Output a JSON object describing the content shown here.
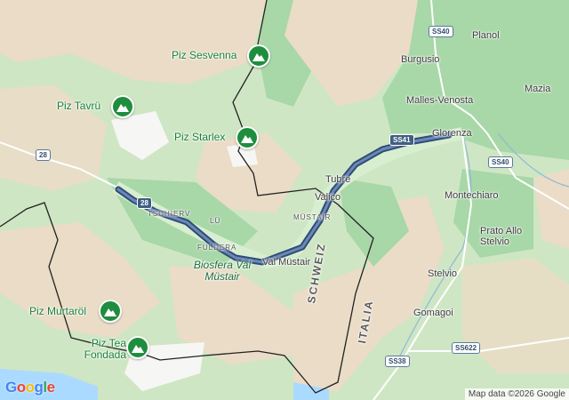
{
  "map": {
    "attribution": "Map data ©2026 Google",
    "logo": {
      "letters": [
        "G",
        "o",
        "o",
        "g",
        "l",
        "e"
      ],
      "colors": [
        "#4285F4",
        "#EA4335",
        "#FBBC05",
        "#4285F4",
        "#34A853",
        "#EA4335"
      ]
    },
    "colors": {
      "route": "#3a5a8a",
      "terrain_green": "#cfe6c4",
      "mountain_tan": "#eadcc6",
      "peak_marker": "#1e8e3e",
      "border": "#222222"
    },
    "places": {
      "planol": "Planol",
      "burgusio": "Burgusio",
      "mazia": "Mazia",
      "malles_venosta": "Malles-Venosta",
      "glorenza": "Glorenza",
      "tubre": "Tubre",
      "valico": "Valico",
      "montechiaro": "Montechiaro",
      "prato_allo_stelvio": "Prato Allo Stelvio",
      "stelvio": "Stelvio",
      "gomagoi": "Gomagoi",
      "val_mustair": "Val Müstair",
      "tschierv": "TSCHIERV",
      "lu": "LÜ",
      "fuldera": "FULDERA",
      "mustair": "MÜSTAIR"
    },
    "peaks": {
      "sesvenna": "Piz Sesvenna",
      "tavru": "Piz Tavrü",
      "starlex": "Piz Starlex",
      "murtarol": "Piz Murtaröl",
      "tea_fondada": "Piz Tea Fondada"
    },
    "park": "Biosfera Val Müstair",
    "countries": {
      "schweiz": "SCHWEIZ",
      "italia": "ITALIA"
    },
    "roads": {
      "ss40_top": "SS40",
      "ss41": "SS41",
      "ss40_right": "SS40",
      "ss622": "SS622",
      "ss38": "SS38",
      "r28": "28",
      "r28_route": "28"
    },
    "icons": {
      "peak": "mountain-icon"
    }
  }
}
